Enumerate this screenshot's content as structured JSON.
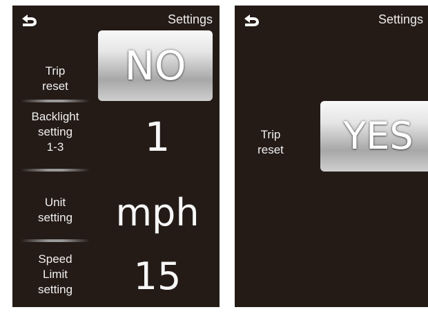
{
  "screens": [
    {
      "title": "Settings",
      "rows": [
        {
          "label_lines": [
            "Trip",
            "reset"
          ],
          "value": "NO"
        },
        {
          "label_lines": [
            "Backlight",
            "setting",
            "1-3"
          ],
          "value": "1"
        },
        {
          "label_lines": [
            "Unit",
            "setting"
          ],
          "value": "mph"
        },
        {
          "label_lines": [
            "Speed",
            "Limit",
            "setting"
          ],
          "value": "15"
        }
      ]
    },
    {
      "title": "Settings",
      "rows": [
        {
          "label_lines": [
            "Trip",
            "reset"
          ],
          "value": "YES"
        }
      ]
    }
  ],
  "icons": {
    "back": "back-arrow-icon"
  },
  "colors": {
    "screen_bg": "#241b17",
    "text": "#f2f2f2",
    "button_light": "#f8f8f8",
    "button_dark": "#a7a7a7"
  }
}
